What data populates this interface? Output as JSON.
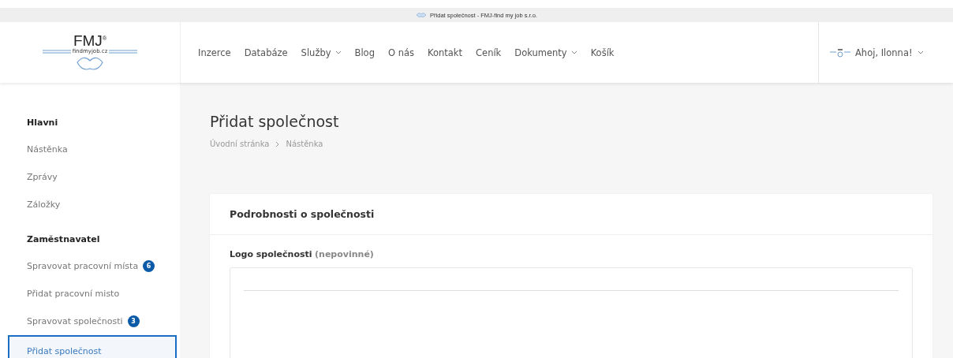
{
  "browser_tab": {
    "title": "Přidat společnost - FMJ-find my job s.r.o."
  },
  "logo": {
    "brand": "FMJ$^{®}$",
    "domain": "findmyjob.cz"
  },
  "nav": [
    {
      "label": "Inzerce",
      "dropdown": false
    },
    {
      "label": "Databáze",
      "dropdown": false
    },
    {
      "label": "Služby",
      "dropdown": true
    },
    {
      "label": "Blog",
      "dropdown": false
    },
    {
      "label": "O nás",
      "dropdown": false
    },
    {
      "label": "Kontakt",
      "dropdown": false
    },
    {
      "label": "Ceník",
      "dropdown": false
    },
    {
      "label": "Dokumenty",
      "dropdown": true
    },
    {
      "label": "Košík",
      "dropdown": false
    }
  ],
  "user": {
    "greeting": "Ahoj, Ilonna!"
  },
  "sidebar": {
    "sections": [
      {
        "heading": "Hlavni",
        "items": [
          {
            "label": "Nástěnka",
            "selected": false
          },
          {
            "label": "Zprávy",
            "selected": false
          },
          {
            "label": "Záložky",
            "selected": false
          }
        ]
      },
      {
        "heading": "Zaměstnavatel",
        "items": [
          {
            "label": "Spravovat pracovní místa",
            "badge": "6",
            "selected": false
          },
          {
            "label": "Přidat pracovní misto",
            "selected": false
          },
          {
            "label": "Spravovat společnosti",
            "badge": "3",
            "selected": false
          },
          {
            "label": "Přidat společnost",
            "selected": true
          }
        ]
      }
    ]
  },
  "page": {
    "title": "Přidat společnost",
    "breadcrumb": [
      "Úvodní stránka",
      "Nástěnka"
    ]
  },
  "card": {
    "title": "Podrobnosti o společnosti",
    "field_label": "Logo společnosti",
    "field_hint": "(nepovinné)"
  }
}
